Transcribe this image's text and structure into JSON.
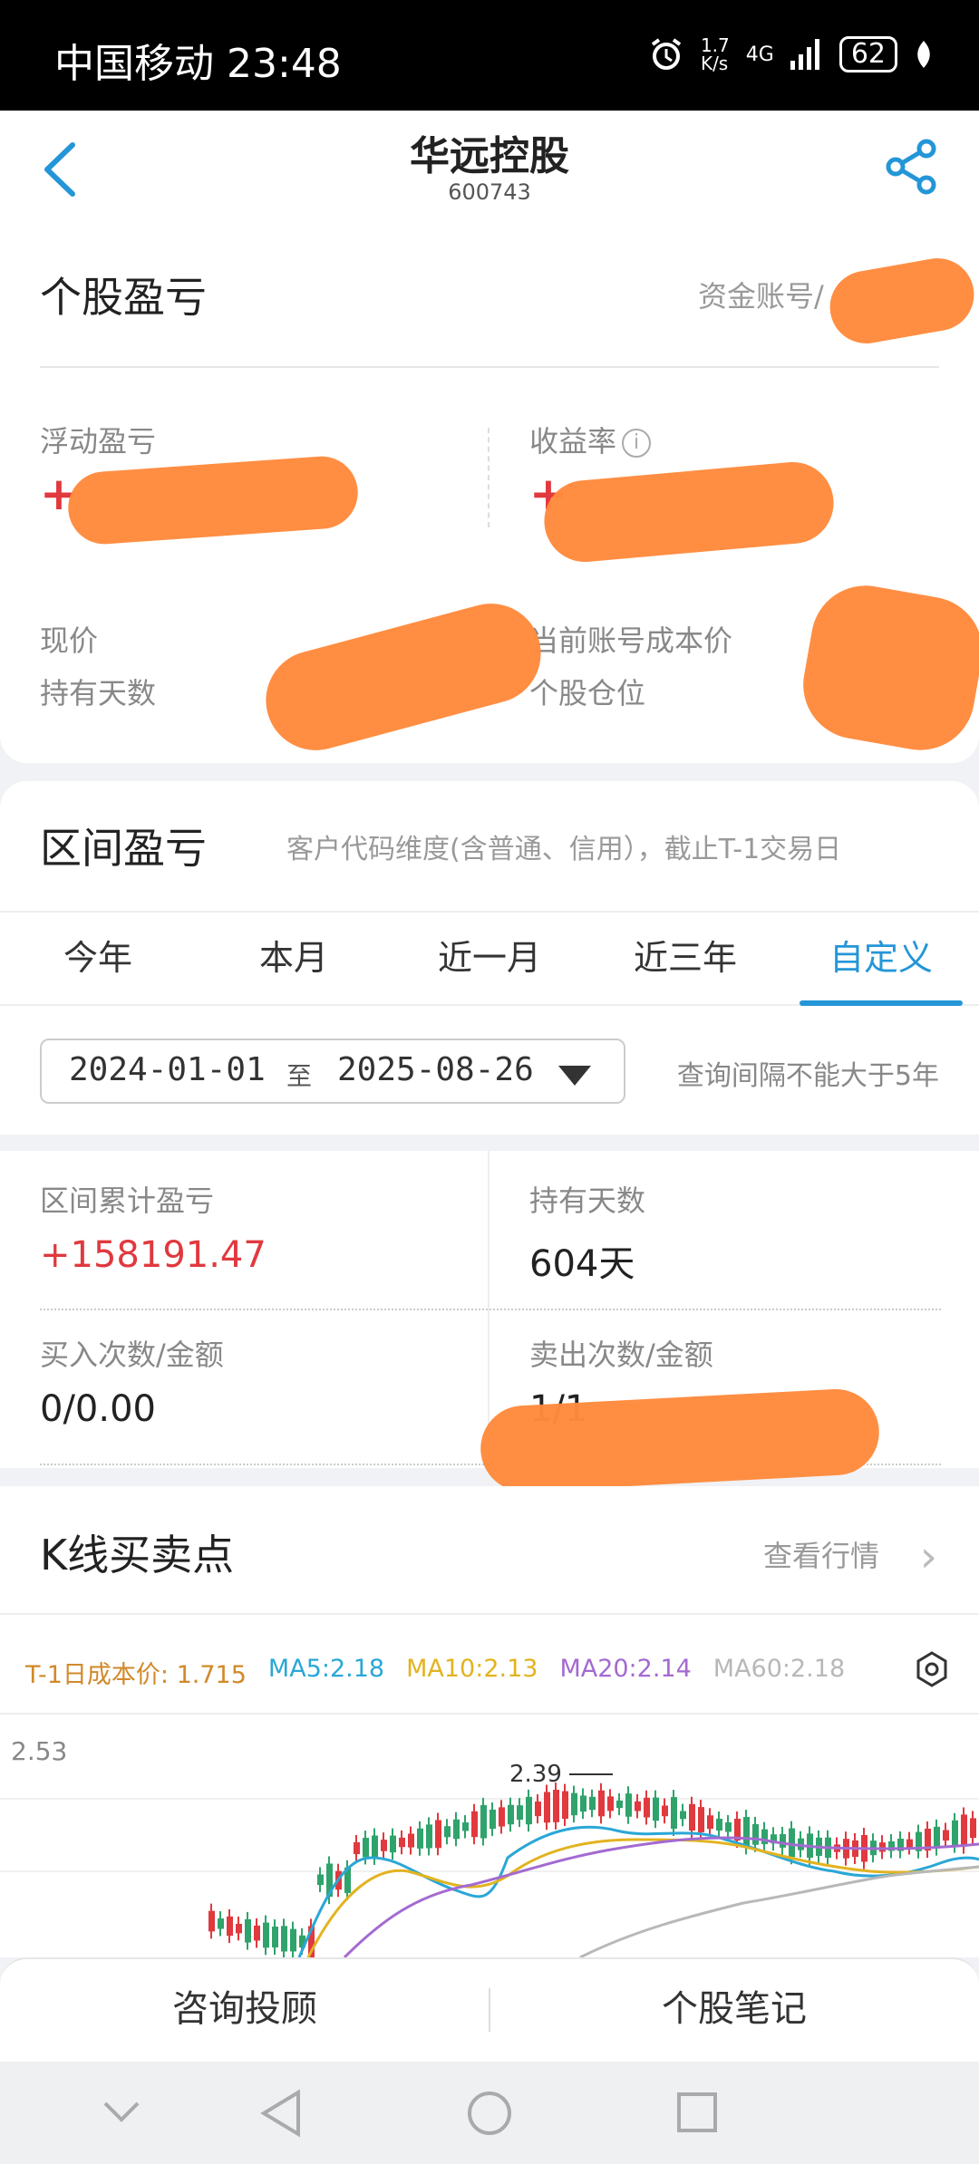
{
  "status": {
    "carrier": "中国移动",
    "time": "23:48",
    "speed": "1.7\nK/s",
    "network": "4G",
    "battery": "62"
  },
  "header": {
    "title": "华远控股",
    "code": "600743"
  },
  "holding": {
    "title": "个股盈亏",
    "account_label": "资金账号/",
    "floating_pl_label": "浮动盈亏",
    "floating_pl_sign": "+",
    "yield_label": "收益率",
    "yield_sign": "+",
    "price_label": "现价",
    "cost_label": "当前账号成本价",
    "days_label": "持有天数",
    "position_label": "个股仓位"
  },
  "period": {
    "title": "区间盈亏",
    "subtitle": "客户代码维度(含普通、信用），截止T-1交易日",
    "tabs": [
      "今年",
      "本月",
      "近一月",
      "近三年",
      "自定义"
    ],
    "active_tab": "自定义",
    "date_from": "2024-01-01",
    "date_to_sep": "至",
    "date_to": "2025-08-26",
    "note": "查询间隔不能大于5年",
    "cum_pl_label": "区间累计盈亏",
    "cum_pl_value": "+158191.47",
    "hold_days_label": "持有天数",
    "hold_days_value": "604天",
    "buy_label": "买入次数/金额",
    "buy_value": "0/0.00",
    "sell_label": "卖出次数/金额",
    "sell_value": "1/1"
  },
  "kline": {
    "title": "K线买卖点",
    "view_quote": "查看行情",
    "legend": {
      "cost": "T-1日成本价: 1.715",
      "ma5": "MA5:2.18",
      "ma10": "MA10:2.13",
      "ma20": "MA20:2.14",
      "ma60": "MA60:2.18"
    },
    "colors": {
      "cost": "#d1892a",
      "ma5": "#2aa7d6",
      "ma10": "#e2b320",
      "ma20": "#a36ad1",
      "ma60": "#b8b8b8",
      "up": "#e0393e",
      "down": "#2fa36b"
    },
    "y_max_label": "2.53",
    "peak_label": "2.39"
  },
  "bottom": {
    "consult": "咨询投顾",
    "notes": "个股笔记"
  }
}
